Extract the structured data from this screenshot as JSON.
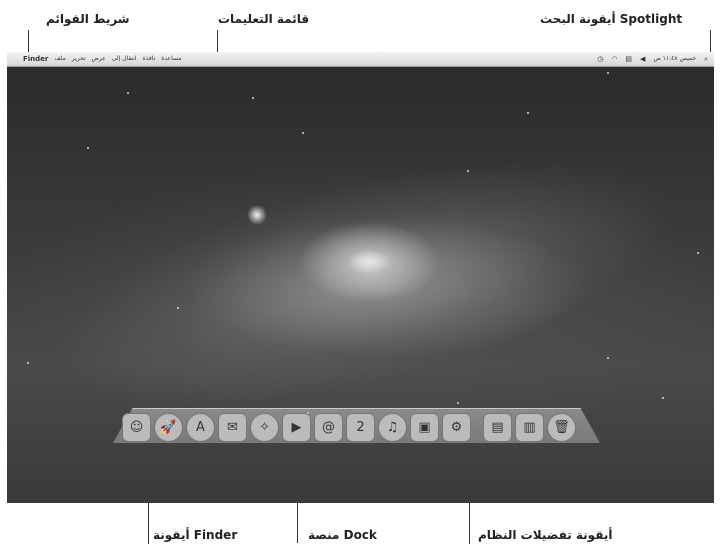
{
  "callouts": {
    "menubar": "شريط القوائم",
    "help_menu": "قائمة التعليمات",
    "spotlight": "أيقونة البحث Spotlight",
    "finder": "أيقونة Finder",
    "dock": "منصة Dock",
    "system_prefs": "أيقونة تفضيلات النظام"
  },
  "menubar": {
    "apple_symbol": "",
    "app_name": "Finder",
    "menus": [
      "ملف",
      "تحرير",
      "عرض",
      "انتقال إلى",
      "نافذة",
      "مساعدة"
    ],
    "clock": "خميس ١١:٤٨ ص",
    "status_icons": [
      "spotlight-icon",
      "volume-icon",
      "display-icon",
      "wifi-icon",
      "time-machine-icon"
    ]
  },
  "dock": {
    "icons": [
      {
        "name": "finder-icon",
        "glyph": "☺"
      },
      {
        "name": "launchpad-icon",
        "glyph": "🚀"
      },
      {
        "name": "app-store-icon",
        "glyph": "A"
      },
      {
        "name": "mail-icon",
        "glyph": "✉"
      },
      {
        "name": "safari-icon",
        "glyph": "✧"
      },
      {
        "name": "facetime-icon",
        "glyph": "▶"
      },
      {
        "name": "address-book-icon",
        "glyph": "@"
      },
      {
        "name": "ical-icon",
        "glyph": "2"
      },
      {
        "name": "itunes-icon",
        "glyph": "♫"
      },
      {
        "name": "photo-booth-icon",
        "glyph": "▣"
      },
      {
        "name": "system-preferences-icon",
        "glyph": "⚙"
      },
      {
        "name": "documents-stack-icon",
        "glyph": "▤"
      },
      {
        "name": "downloads-stack-icon",
        "glyph": "▥"
      },
      {
        "name": "trash-icon",
        "glyph": "🗑"
      }
    ]
  }
}
